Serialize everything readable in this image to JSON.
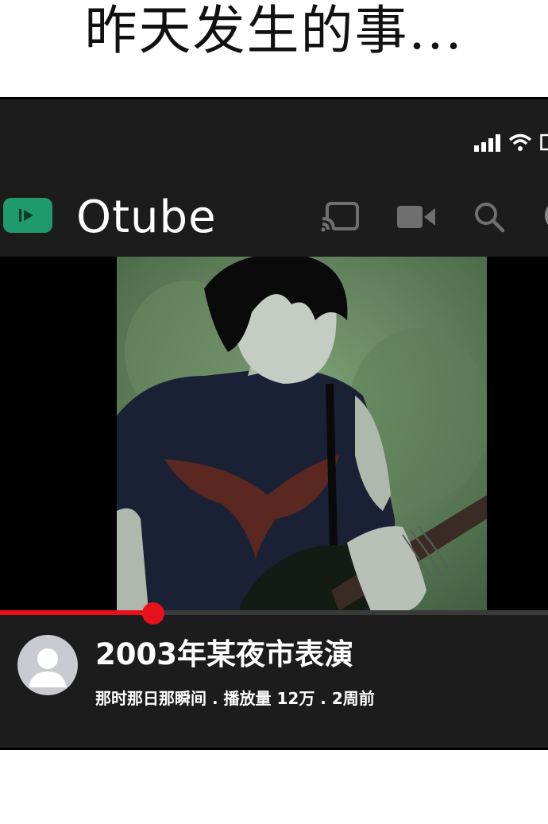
{
  "caption": "昨天发生的事...",
  "app": {
    "name": "Otube",
    "logo_color": "#1f9a6e",
    "icons": [
      "cast-icon",
      "video-camera-icon",
      "search-icon",
      "profile-icon"
    ]
  },
  "status_bar": {
    "icons": [
      "signal-icon",
      "wifi-icon",
      "battery-icon"
    ]
  },
  "video": {
    "title": "2003年某夜市表演",
    "meta": "那时那日那瞬间 . 播放量 12万 . 2周前",
    "progress_fraction": 0.28,
    "progress_color": "#e8101a"
  }
}
